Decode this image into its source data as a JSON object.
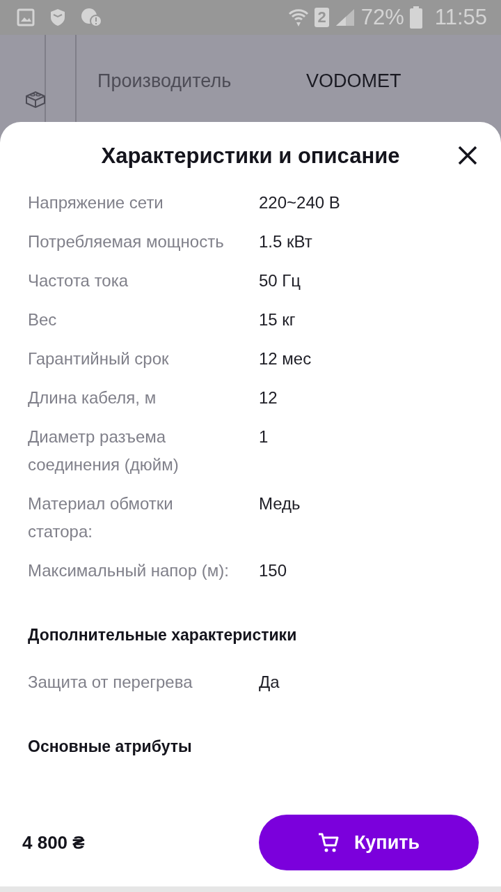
{
  "status_bar": {
    "battery": "72%",
    "sim_slot": "2",
    "time": "11:55"
  },
  "background": {
    "rows": [
      {
        "label": "Производитель",
        "value": "VODOMET"
      }
    ]
  },
  "sheet": {
    "title": "Характеристики и описание",
    "items": [
      {
        "kind": "row",
        "label": "Напряжение сети",
        "value": "220~240 В"
      },
      {
        "kind": "row",
        "label": "Потребляемая мощность",
        "value": "1.5 кВт"
      },
      {
        "kind": "row",
        "label": "Частота тока",
        "value": "50 Гц"
      },
      {
        "kind": "row",
        "label": "Вес",
        "value": "15 кг"
      },
      {
        "kind": "row",
        "label": "Гарантийный срок",
        "value": "12 мес"
      },
      {
        "kind": "row",
        "label": "Длина кабеля, м",
        "value": "12"
      },
      {
        "kind": "row",
        "label": "Диаметр разъема соединения (дюйм)",
        "value": "1"
      },
      {
        "kind": "row",
        "label": "Материал обмотки статора:",
        "value": "Медь"
      },
      {
        "kind": "row",
        "label": "Максимальный напор (м):",
        "value": "150"
      },
      {
        "kind": "heading",
        "label": "Дополнительные характеристики"
      },
      {
        "kind": "row",
        "label": "Защита от перегрева",
        "value": "Да"
      },
      {
        "kind": "heading",
        "label": "Основные атрибуты"
      }
    ],
    "price": "4 800 ₴",
    "buy_button": "Купить"
  }
}
